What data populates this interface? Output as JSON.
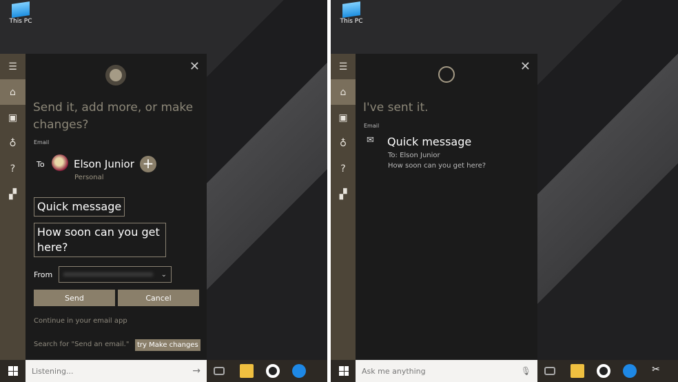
{
  "desktop": {
    "icon_label": "This PC"
  },
  "left": {
    "prompt": "Send it, add more, or make changes?",
    "section_label": "Email",
    "to_label": "To",
    "recipient_name": "Elson Junior",
    "recipient_type": "Personal",
    "subject": "Quick message",
    "body": "How soon can you get here?",
    "from_label": "From",
    "send_label": "Send",
    "cancel_label": "Cancel",
    "continue_link": "Continue in your email app",
    "search_link": "Search for \"Send an email.\"",
    "tooltip": "try Make changes",
    "search_text": "Listening..."
  },
  "right": {
    "prompt": "I've sent it.",
    "section_label": "Email",
    "subject": "Quick message",
    "to_line": "To: Elson Junior",
    "body": "How soon can you get here?",
    "search_placeholder": "Ask me anything"
  },
  "colors": {
    "accent": "#8a7f6a",
    "sidebar": "#4d4538",
    "pane": "#1b1b1b"
  }
}
